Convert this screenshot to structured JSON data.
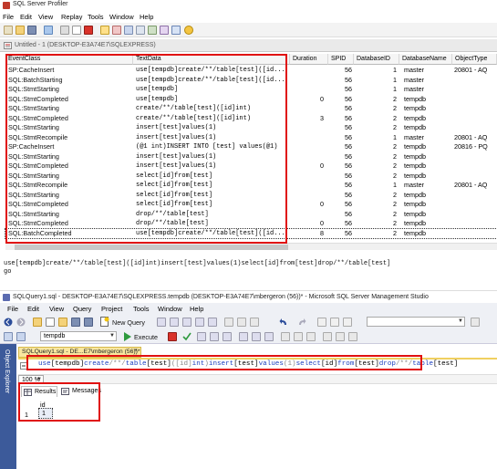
{
  "profiler": {
    "title": "SQL Server Profiler",
    "menu": [
      "File",
      "Edit",
      "View",
      "Replay",
      "Tools",
      "Window",
      "Help"
    ],
    "doc_tab": "Untitled - 1 (DESKTOP-E3A74E7\\SQLEXPRESS)",
    "columns": [
      "EventClass",
      "TextData",
      "Duration",
      "SPID",
      "DatabaseID",
      "DatabaseName",
      "ObjectType"
    ],
    "rows": [
      {
        "event": "SP:CacheInsert",
        "text": "use[tempdb]create/**/table[test]([id...",
        "duration": "",
        "spid": "56",
        "dbid": "1",
        "dbname": "master",
        "objtype": "20801 - AQ"
      },
      {
        "event": "SQL:BatchStarting",
        "text": "use[tempdb]create/**/table[test]([id...",
        "duration": "",
        "spid": "56",
        "dbid": "1",
        "dbname": "master",
        "objtype": ""
      },
      {
        "event": "SQL:StmtStarting",
        "text": "use[tempdb]",
        "duration": "",
        "spid": "56",
        "dbid": "1",
        "dbname": "master",
        "objtype": ""
      },
      {
        "event": "SQL:StmtCompleted",
        "text": "use[tempdb]",
        "duration": "0",
        "spid": "56",
        "dbid": "2",
        "dbname": "tempdb",
        "objtype": ""
      },
      {
        "event": "SQL:StmtStarting",
        "text": "create/**/table[test]([id]int)",
        "duration": "",
        "spid": "56",
        "dbid": "2",
        "dbname": "tempdb",
        "objtype": ""
      },
      {
        "event": "SQL:StmtCompleted",
        "text": "create/**/table[test]([id]int)",
        "duration": "3",
        "spid": "56",
        "dbid": "2",
        "dbname": "tempdb",
        "objtype": ""
      },
      {
        "event": "SQL:StmtStarting",
        "text": "insert[test]values(1)",
        "duration": "",
        "spid": "56",
        "dbid": "2",
        "dbname": "tempdb",
        "objtype": ""
      },
      {
        "event": "SQL:StmtRecompile",
        "text": "insert[test]values(1)",
        "duration": "",
        "spid": "56",
        "dbid": "1",
        "dbname": "master",
        "objtype": "20801 - AQ"
      },
      {
        "event": "SP:CacheInsert",
        "text": "(@1 int)INSERT INTO [test] values(@1)",
        "duration": "",
        "spid": "56",
        "dbid": "2",
        "dbname": "tempdb",
        "objtype": "20816 - PQ"
      },
      {
        "event": "SQL:StmtStarting",
        "text": "insert[test]values(1)",
        "duration": "",
        "spid": "56",
        "dbid": "2",
        "dbname": "tempdb",
        "objtype": ""
      },
      {
        "event": "SQL:StmtCompleted",
        "text": "insert[test]values(1)",
        "duration": "0",
        "spid": "56",
        "dbid": "2",
        "dbname": "tempdb",
        "objtype": ""
      },
      {
        "event": "SQL:StmtStarting",
        "text": "select[id]from[test]",
        "duration": "",
        "spid": "56",
        "dbid": "2",
        "dbname": "tempdb",
        "objtype": ""
      },
      {
        "event": "SQL:StmtRecompile",
        "text": "select[id]from[test]",
        "duration": "",
        "spid": "56",
        "dbid": "1",
        "dbname": "master",
        "objtype": "20801 - AQ"
      },
      {
        "event": "SQL:StmtStarting",
        "text": "select[id]from[test]",
        "duration": "",
        "spid": "56",
        "dbid": "2",
        "dbname": "tempdb",
        "objtype": ""
      },
      {
        "event": "SQL:StmtCompleted",
        "text": "select[id]from[test]",
        "duration": "0",
        "spid": "56",
        "dbid": "2",
        "dbname": "tempdb",
        "objtype": ""
      },
      {
        "event": "SQL:StmtStarting",
        "text": "drop/**/table[test]",
        "duration": "",
        "spid": "56",
        "dbid": "2",
        "dbname": "tempdb",
        "objtype": ""
      },
      {
        "event": "SQL:StmtCompleted",
        "text": "drop/**/table[test]",
        "duration": "0",
        "spid": "56",
        "dbid": "2",
        "dbname": "tempdb",
        "objtype": ""
      },
      {
        "event": "SQL:BatchCompleted",
        "text": "use[tempdb]create/**/table[test]([id...",
        "duration": "8",
        "spid": "56",
        "dbid": "2",
        "dbname": "tempdb",
        "objtype": ""
      }
    ],
    "output_line1": "use[tempdb]create/**/table[test]([id]int)insert[test]values(1)select[id]from[test]drop/**/table[test]",
    "output_line2": "go"
  },
  "ssms": {
    "title": "SQLQuery1.sql - DESKTOP-E3A74E7\\SQLEXPRESS.tempdb (DESKTOP-E3A74E7\\mbergeron (56))* - Microsoft SQL Server Management Studio",
    "menu": [
      "File",
      "Edit",
      "View",
      "Query",
      "Project",
      "Tools",
      "Window",
      "Help"
    ],
    "new_query_label": "New Query",
    "database": "tempdb",
    "execute_label": "Execute",
    "object_explorer_label": "Object Explorer",
    "query_tab_label": "SQLQuery1.sql - DE...E7\\mbergeron (56))*",
    "query_tokens": [
      {
        "t": "use",
        "c": "kw"
      },
      {
        "t": "[tempdb]",
        "c": ""
      },
      {
        "t": "create",
        "c": "kw"
      },
      {
        "t": "/**/",
        "c": "gr"
      },
      {
        "t": "table",
        "c": "kw"
      },
      {
        "t": "[test]",
        "c": ""
      },
      {
        "t": "([id]",
        "c": "gr"
      },
      {
        "t": "int",
        "c": "kw"
      },
      {
        "t": ")",
        "c": "gr"
      },
      {
        "t": "insert",
        "c": "kw"
      },
      {
        "t": "[test]",
        "c": ""
      },
      {
        "t": "values",
        "c": "kw"
      },
      {
        "t": "(1)",
        "c": "gr"
      },
      {
        "t": "select",
        "c": "kw"
      },
      {
        "t": "[id]",
        "c": ""
      },
      {
        "t": "from",
        "c": "kw"
      },
      {
        "t": "[test]",
        "c": ""
      },
      {
        "t": "drop",
        "c": "kw"
      },
      {
        "t": "/**/",
        "c": "gr"
      },
      {
        "t": "table",
        "c": "kw"
      },
      {
        "t": "[test]",
        "c": ""
      }
    ],
    "zoom": "100 %",
    "results_tab": "Results",
    "messages_tab": "Messages",
    "result_column": "id",
    "result_row_num": "1",
    "result_value": "1"
  }
}
